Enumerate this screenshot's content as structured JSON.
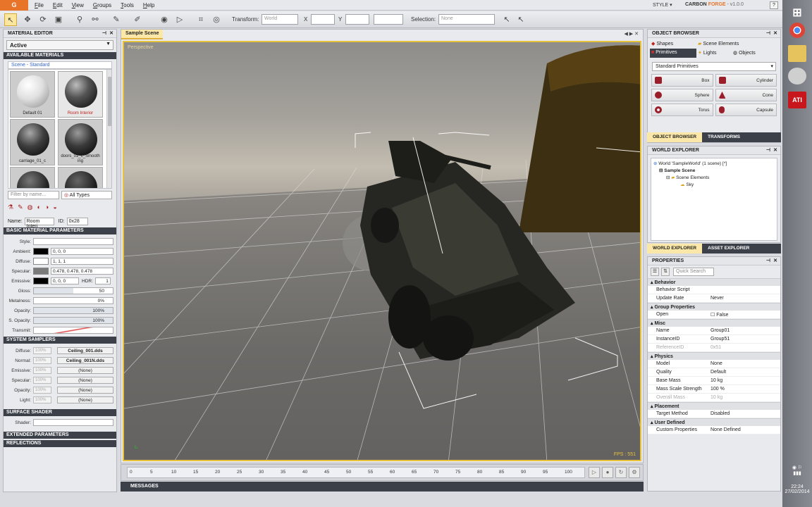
{
  "app": {
    "logo": "G",
    "menu": [
      "File",
      "Edit",
      "View",
      "Groups",
      "Tools",
      "Help"
    ],
    "style_menu": "STYLE ▾",
    "brand": "CARBON",
    "brand_accent": "FORGE",
    "version": "- v1.0.0",
    "help": "?"
  },
  "toolbar": {
    "transform_label": "Transform:",
    "transform_value": "World",
    "x_label": "X",
    "y_label": "Y",
    "selection_label": "Selection:",
    "selection_value": "None"
  },
  "material_editor": {
    "title": "MATERIAL EDITOR",
    "mode": "Active",
    "available_header": "AVAILABLE MATERIALS",
    "list_title": "Scene - Standard",
    "materials": [
      {
        "name": "Default 01",
        "selected": false
      },
      {
        "name": "Room Interior",
        "selected": true
      },
      {
        "name": "carriage_01_c",
        "selected": false
      },
      {
        "name": "doors_01_c_Smooth ing",
        "selected": false
      }
    ],
    "filter_placeholder": "Filter by name...",
    "filter_types": "All Types",
    "name_label": "Name:",
    "name_value": "Room Interi",
    "id_label": "ID:",
    "id_value": "0x28",
    "basic_header": "BASIC MATERIAL PARAMETERS",
    "params": {
      "style": "Style:",
      "ambient_label": "Ambient:",
      "ambient_value": "0, 0, 0",
      "diffuse_label": "Diffuse:",
      "diffuse_value": "1, 1, 1",
      "specular_label": "Specular:",
      "specular_value": "0.478, 0.478, 0.478",
      "emissive_label": "Emissive:",
      "emissive_value": "0, 0, 0",
      "hdr_label": "HDR:",
      "hdr_value": "1",
      "gloss_label": "Gloss:",
      "gloss_value": "50",
      "metalness_label": "Metalness:",
      "metalness_value": "0%",
      "opacity_label": "Opacity:",
      "opacity_value": "100%",
      "sopacity_label": "S. Opacity:",
      "sopacity_value": "100%",
      "transmit_label": "Transmit:"
    },
    "samplers_header": "SYSTEM SAMPLERS",
    "samplers": [
      {
        "label": "Diffuse:",
        "pct": "100%",
        "texture": "Ceiling_001.dds"
      },
      {
        "label": "Normal:",
        "pct": "100%",
        "texture": "Ceiling_001N.dds"
      },
      {
        "label": "Emissive:",
        "pct": "100%",
        "texture": "(None)"
      },
      {
        "label": "Specular:",
        "pct": "100%",
        "texture": "(None)"
      },
      {
        "label": "Opacity:",
        "pct": "100%",
        "texture": "(None)"
      },
      {
        "label": "Light:",
        "pct": "100%",
        "texture": "(None)"
      }
    ],
    "surface_header": "SURFACE SHADER",
    "shader_label": "Shader:",
    "extended_header": "EXTENDED PARAMETERS",
    "reflections_header": "REFLECTIONS"
  },
  "viewport": {
    "tab": "Sample Scene",
    "nav": "◀ ▶ ✕",
    "label": "Perspective",
    "fps": "FPS : 551"
  },
  "timeline": {
    "ticks": [
      "0",
      "5",
      "10",
      "15",
      "20",
      "25",
      "30",
      "35",
      "40",
      "45",
      "50",
      "55",
      "60",
      "65",
      "70",
      "75",
      "80",
      "85",
      "90",
      "95",
      "100"
    ],
    "messages": "MESSAGES"
  },
  "object_browser": {
    "title": "OBJECT BROWSER",
    "tabs": [
      "Shapes",
      "Scene Elements",
      "Primitives",
      "Lights",
      "Objects"
    ],
    "category": "Standard Primitives",
    "primitives": [
      "Box",
      "Cylinder",
      "Sphere",
      "Cone",
      "Torus",
      "Capsule"
    ],
    "bottom_tabs": [
      "OBJECT BROWSER",
      "TRANSFORMS"
    ]
  },
  "world_explorer": {
    "title": "WORLD EXPLORER",
    "tree": [
      "World 'SampleWorld' (1 scene) [*]",
      "Sample Scene",
      "Scene Elements",
      "Sky"
    ],
    "bottom_tabs": [
      "WORLD EXPLORER",
      "ASSET EXPLORER"
    ]
  },
  "properties": {
    "title": "PROPERTIES",
    "search_placeholder": "Quick Search",
    "categories": [
      {
        "name": "Behavior",
        "rows": [
          {
            "k": "Behavior Script",
            "v": ""
          },
          {
            "k": "Update Rate",
            "v": "Never"
          }
        ]
      },
      {
        "name": "Group Properties",
        "rows": [
          {
            "k": "Open",
            "v": "False"
          }
        ]
      },
      {
        "name": "Misc",
        "rows": [
          {
            "k": "Name",
            "v": "Group01"
          },
          {
            "k": "InstanceID",
            "v": "Group51"
          },
          {
            "k": "ReferenceID",
            "v": "0x51",
            "dim": true
          }
        ]
      },
      {
        "name": "Physics",
        "rows": [
          {
            "k": "Model",
            "v": "None"
          },
          {
            "k": "Quality",
            "v": "Default"
          },
          {
            "k": "Base Mass",
            "v": "10 kg"
          },
          {
            "k": "Mass Scale Strength",
            "v": "100 %"
          },
          {
            "k": "Overall Mass",
            "v": "10 kg",
            "dim": true
          }
        ]
      },
      {
        "name": "Placement",
        "rows": [
          {
            "k": "Target Method",
            "v": "Disabled"
          }
        ]
      },
      {
        "name": "User Defined",
        "rows": [
          {
            "k": "Custom Properties",
            "v": "None Defined"
          }
        ]
      }
    ]
  },
  "system_tray": {
    "time": "22:24",
    "date": "27/02/2014"
  },
  "colors": {
    "accent": "#e8c23a",
    "logo": "#e8742a",
    "section": "#3c4049"
  }
}
